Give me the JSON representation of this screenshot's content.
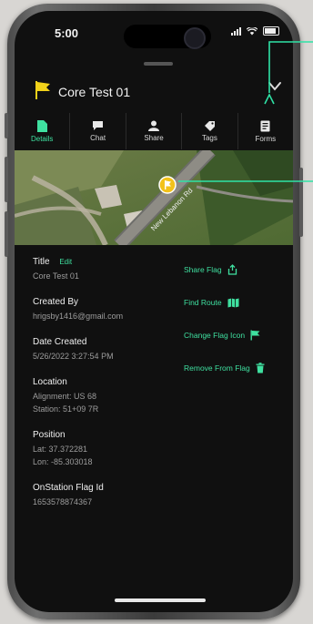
{
  "status": {
    "time": "5:00"
  },
  "header": {
    "title": "Core Test 01"
  },
  "tabs": [
    {
      "label": "Details",
      "icon": "file-icon",
      "active": true
    },
    {
      "label": "Chat",
      "icon": "chat-bubble-icon",
      "active": false
    },
    {
      "label": "Share",
      "icon": "person-icon",
      "active": false
    },
    {
      "label": "Tags",
      "icon": "tag-icon",
      "active": false
    },
    {
      "label": "Forms",
      "icon": "document-icon",
      "active": false
    }
  ],
  "map": {
    "road_label": "New Lebanon Rd"
  },
  "details": {
    "title_label": "Title",
    "edit_label": "Edit",
    "title_value": "Core Test 01",
    "created_by_label": "Created By",
    "created_by_value": "hrigsby1416@gmail.com",
    "date_created_label": "Date Created",
    "date_created_value": "5/26/2022 3:27:54 PM",
    "location_label": "Location",
    "location_alignment": "Alignment: US 68",
    "location_station": "Station: 51+09 7R",
    "position_label": "Position",
    "position_lat": "Lat: 37.372281",
    "position_lon": "Lon: -85.303018",
    "flag_id_label": "OnStation Flag Id",
    "flag_id_value": "1653578874367"
  },
  "actions": {
    "share_flag": "Share Flag",
    "find_route": "Find Route",
    "change_icon": "Change Flag Icon",
    "remove": "Remove From Flag"
  },
  "colors": {
    "accent": "#3fe0a0",
    "flag": "#f2d21a",
    "background": "#101010"
  }
}
